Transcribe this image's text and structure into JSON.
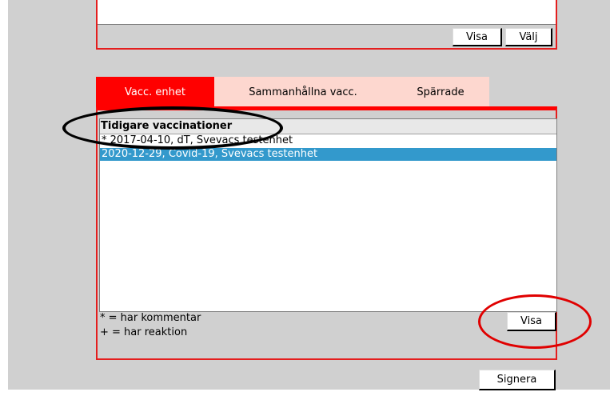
{
  "top_panel": {
    "visa_label": "Visa",
    "valj_label": "Välj"
  },
  "tabs": [
    {
      "label": "Vacc. enhet",
      "active": true
    },
    {
      "label": "Sammanhållna vacc.",
      "active": false
    },
    {
      "label": "Spärrade",
      "active": false
    }
  ],
  "vaccinations": {
    "header": "Tidigare vaccinationer",
    "items": [
      {
        "text": "* 2017-04-10, dT, Svevacs testenhet",
        "selected": false
      },
      {
        "text": "2020-12-29, Covid-19, Svevacs testenhet",
        "selected": true
      }
    ]
  },
  "legend": {
    "comment": "* = har kommentar",
    "reaction": "+ = har reaktion"
  },
  "buttons": {
    "visa_label": "Visa",
    "signera_label": "Signera"
  },
  "colors": {
    "accent_red": "#ff0000",
    "tab_inactive": "#fdd7cf",
    "selection_blue": "#3399cc",
    "panel_gray": "#d0d0d0"
  }
}
